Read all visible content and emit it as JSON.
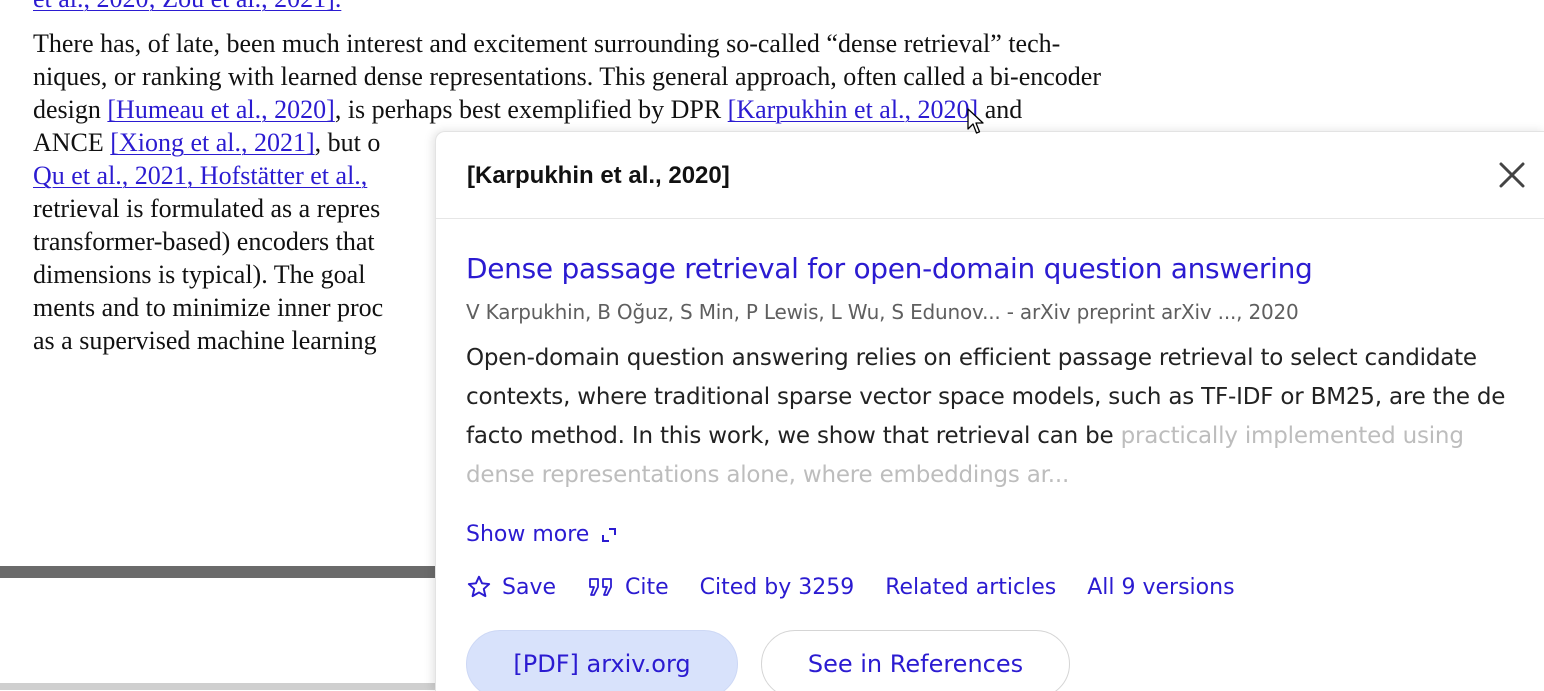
{
  "pdf": {
    "line0": "et al., 2020; Zou et al., 2021].",
    "p1": {
      "text": "There has, of late, been much interest and excitement surrounding so-called “dense retrieval” tech-"
    },
    "p2": {
      "text": "niques, or ranking with learned dense representations. This general approach, often called a bi-encoder"
    },
    "p3": {
      "a": "design ",
      "cite1": "[Humeau et al., 2020]",
      "b": ", is perhaps best exemplified by DPR ",
      "cite2": "[Karpukhin et al., 2020]",
      "c": " and"
    },
    "p4": {
      "a": "ANCE ",
      "cite": "[Xiong et al., 2021]",
      "b": ", but o"
    },
    "p5": {
      "cite": "Qu et al., 2021, Hofstätter et al.,"
    },
    "p6": {
      "text": "retrieval is formulated as a repres"
    },
    "p7": {
      "text": "transformer-based) encoders that"
    },
    "p8": {
      "text": "dimensions is typical). The goal"
    },
    "p9": {
      "text": "ments and to minimize inner proc"
    },
    "p10": {
      "text": "as a supervised machine learning"
    }
  },
  "popup": {
    "header_title": "[Karpukhin et al., 2020]",
    "result_title": "Dense passage retrieval for open-domain question answering",
    "authors": "V Karpukhin, B Oğuz, S Min, P Lewis, L Wu, S Edunov... - arXiv preprint arXiv ..., 2020",
    "snippet_visible": "Open-domain question answering relies on efficient passage retrieval to select candidate contexts, where traditional sparse vector space models, such as TF-IDF or BM25, are the de facto method. In this work, we show that retrieval can be",
    "snippet_faded": "practically implemented using dense representations alone, where embeddings ar...",
    "show_more": "Show more",
    "actions": {
      "save": "Save",
      "cite": "Cite",
      "cited_by": "Cited by 3259",
      "related": "Related articles",
      "versions": "All 9 versions"
    },
    "buttons": {
      "pdf": "[PDF] arxiv.org",
      "references": "See in References"
    }
  },
  "colors": {
    "link": "#2b1bd1",
    "pdf_button_bg": "#d8e2fb"
  },
  "icons": [
    "close-icon",
    "star-icon",
    "quote-icon",
    "expand-icon",
    "mouse-cursor-icon"
  ]
}
